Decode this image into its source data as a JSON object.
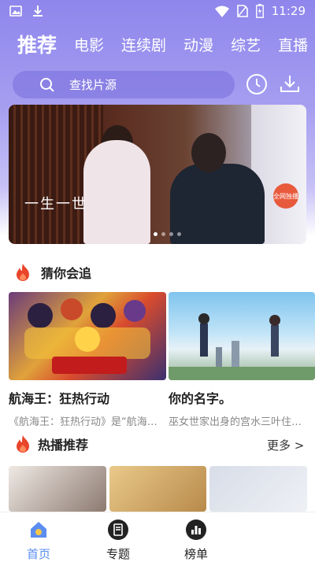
{
  "status_bar": {
    "time": "11:29",
    "icons": [
      "image-icon",
      "download-icon",
      "wifi-icon",
      "sim-icon",
      "battery-icon"
    ]
  },
  "tabs": [
    {
      "label": "推荐",
      "active": true
    },
    {
      "label": "电影",
      "active": false
    },
    {
      "label": "连续剧",
      "active": false
    },
    {
      "label": "动漫",
      "active": false
    },
    {
      "label": "综艺",
      "active": false
    },
    {
      "label": "直播",
      "active": false
    }
  ],
  "search": {
    "placeholder": "查找片源"
  },
  "banner": {
    "title_text": "一生一世",
    "badge_text": "全网独播",
    "dot_count": 4,
    "active_dot": 1
  },
  "section_guess": {
    "title": "猜你会追",
    "icon": "flame-icon"
  },
  "guess_cards": [
    {
      "name": "航海王：狂热行动",
      "desc": "《航海王：狂热行动》是“航海…"
    },
    {
      "name": "你的名字。",
      "desc": "巫女世家出身的宫水三叶住在…"
    }
  ],
  "section_hot": {
    "title": "热播推荐",
    "icon": "flame-icon",
    "more": "更多 >"
  },
  "tabbar": [
    {
      "label": "首页",
      "icon": "home-icon",
      "active": true
    },
    {
      "label": "专题",
      "icon": "topic-icon",
      "active": false
    },
    {
      "label": "榜单",
      "icon": "chart-icon",
      "active": false
    }
  ],
  "colors": {
    "header_gradient_top": "#8e86ec",
    "accent_active": "#5b8ef0",
    "flame": "#e8452a"
  }
}
